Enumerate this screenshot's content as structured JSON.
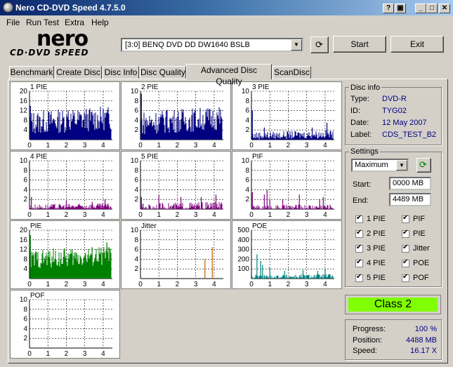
{
  "window": {
    "title": "Nero CD-DVD Speed 4.7.5.0",
    "icon": "cd-icon",
    "controls": [
      "help-icon",
      "restore-icon",
      "minimize-icon",
      "maximize-icon",
      "close-icon"
    ]
  },
  "menu": [
    "File",
    "Run Test",
    "Extra",
    "Help"
  ],
  "logo": {
    "brand": "nero",
    "product": "CD·DVD SPEED"
  },
  "drive": {
    "selected": "[3:0]   BENQ DVD DD DW1640 BSLB"
  },
  "buttons": {
    "start": "Start",
    "exit": "Exit"
  },
  "tabs": [
    "Benchmark",
    "Create Disc",
    "Disc Info",
    "Disc Quality",
    "Advanced Disc Quality",
    "ScanDisc"
  ],
  "active_tab": "Advanced Disc Quality",
  "disc_info": {
    "title": "Disc info",
    "rows": [
      {
        "label": "Type:",
        "value": "DVD-R"
      },
      {
        "label": "ID:",
        "value": "TYG02"
      },
      {
        "label": "Date:",
        "value": "12 May 2007"
      },
      {
        "label": "Label:",
        "value": "CDS_TEST_B2"
      }
    ]
  },
  "settings": {
    "title": "Settings",
    "speed": "Maximum",
    "start_label": "Start:",
    "start_value": "0000 MB",
    "end_label": "End:",
    "end_value": "4489 MB",
    "checkboxes_left": [
      "1 PIE",
      "2 PIE",
      "3 PIE",
      "4 PIE",
      "5 PIE"
    ],
    "checkboxes_right": [
      "PIF",
      "PIE",
      "Jitter",
      "POE",
      "POF"
    ]
  },
  "class_label": "Class 2",
  "status": {
    "progress_label": "Progress:",
    "progress_value": "100 %",
    "position_label": "Position:",
    "position_value": "4488 MB",
    "speed_label": "Speed:",
    "speed_value": "16.17 X"
  },
  "colors": {
    "navy": "#000080",
    "purple": "#800080",
    "green": "#008000",
    "teal": "#008080",
    "orange": "#c06000",
    "class_bg": "#80ff00"
  },
  "chart_data": [
    {
      "type": "bar",
      "title": "1 PIE",
      "ylim": [
        0,
        20
      ],
      "yticks": [
        4,
        8,
        12,
        16,
        20
      ],
      "xticks": [
        0,
        1,
        2,
        3,
        4
      ],
      "xlim": [
        0,
        4.5
      ],
      "color": "navy",
      "base": 7,
      "spread": 5,
      "spikes": [
        [
          0.05,
          14
        ],
        [
          2.1,
          12
        ],
        [
          4.0,
          12
        ]
      ]
    },
    {
      "type": "bar",
      "title": "2 PIE",
      "ylim": [
        0,
        10
      ],
      "yticks": [
        2,
        4,
        6,
        8,
        10
      ],
      "xticks": [
        0,
        1,
        2,
        3,
        4
      ],
      "xlim": [
        0,
        4.5
      ],
      "color": "navy",
      "base": 3.5,
      "spread": 2.5,
      "spikes": [
        [
          0.05,
          9.5
        ],
        [
          1.4,
          6
        ],
        [
          4.2,
          5
        ]
      ]
    },
    {
      "type": "bar",
      "title": "3 PIE",
      "ylim": [
        0,
        10
      ],
      "yticks": [
        2,
        4,
        6,
        8,
        10
      ],
      "xticks": [
        0,
        1,
        2,
        3,
        4
      ],
      "xlim": [
        0,
        4.5
      ],
      "color": "navy",
      "base": 0.8,
      "spread": 0.8,
      "spikes": [
        [
          0.05,
          6
        ],
        [
          0.7,
          2.5
        ],
        [
          3.3,
          2.5
        ],
        [
          4.1,
          3.5
        ]
      ]
    },
    {
      "type": "bar",
      "title": "4 PIE",
      "ylim": [
        0,
        10
      ],
      "yticks": [
        2,
        4,
        6,
        8,
        10
      ],
      "xticks": [
        0,
        1,
        2,
        3,
        4
      ],
      "xlim": [
        0,
        4.5
      ],
      "color": "purple",
      "base": 0.4,
      "spread": 0.6,
      "spikes": [
        [
          0.1,
          2.5
        ],
        [
          2.0,
          1.8
        ],
        [
          3.4,
          1.5
        ],
        [
          4.1,
          2
        ]
      ]
    },
    {
      "type": "bar",
      "title": "5 PIE",
      "ylim": [
        0,
        10
      ],
      "yticks": [
        2,
        4,
        6,
        8,
        10
      ],
      "xticks": [
        0,
        1,
        2,
        3,
        4
      ],
      "xlim": [
        0,
        4.5
      ],
      "color": "purple",
      "base": 0.3,
      "spread": 0.9,
      "spikes": [
        [
          0.05,
          2.5
        ],
        [
          1.0,
          3
        ],
        [
          2.2,
          2.5
        ],
        [
          3.3,
          2.5
        ],
        [
          4.1,
          3
        ]
      ]
    },
    {
      "type": "bar",
      "title": "PIF",
      "ylim": [
        0,
        10
      ],
      "yticks": [
        2,
        4,
        6,
        8,
        10
      ],
      "xticks": [
        0,
        1,
        2,
        3,
        4
      ],
      "xlim": [
        0,
        4.5
      ],
      "color": "purple",
      "base": 0.2,
      "spread": 0.6,
      "spikes": [
        [
          0.05,
          3.5
        ],
        [
          0.7,
          3
        ],
        [
          0.85,
          4
        ],
        [
          1.0,
          2
        ],
        [
          1.7,
          2
        ],
        [
          2.6,
          3
        ],
        [
          3.7,
          2
        ],
        [
          3.9,
          2.5
        ]
      ]
    },
    {
      "type": "bar",
      "title": "PIE",
      "ylim": [
        0,
        20
      ],
      "yticks": [
        4,
        8,
        12,
        16,
        20
      ],
      "xticks": [
        0,
        1,
        2,
        3,
        4
      ],
      "xlim": [
        0,
        4.5
      ],
      "color": "green",
      "base": 8,
      "spread": 4,
      "spikes": [
        [
          0.05,
          18
        ],
        [
          3.4,
          13
        ],
        [
          4.2,
          15
        ]
      ]
    },
    {
      "type": "bar",
      "title": "Jitter",
      "ylim": [
        0,
        10
      ],
      "yticks": [
        2,
        4,
        6,
        8,
        10
      ],
      "xticks": [
        0,
        1,
        2,
        3,
        4
      ],
      "xlim": [
        0,
        4.5
      ],
      "color": "orange",
      "base": 0,
      "spread": 0,
      "spikes": [
        [
          3.5,
          4
        ],
        [
          3.9,
          6.5
        ]
      ]
    },
    {
      "type": "bar",
      "title": "POE",
      "ylim": [
        0,
        500
      ],
      "yticks": [
        100,
        200,
        300,
        400,
        500
      ],
      "xticks": [
        0,
        1,
        2,
        3,
        4
      ],
      "xlim": [
        0,
        4.5
      ],
      "color": "teal",
      "base": 15,
      "spread": 25,
      "spikes": [
        [
          0.3,
          250
        ],
        [
          0.5,
          180
        ],
        [
          0.6,
          140
        ],
        [
          1.0,
          120
        ],
        [
          1.8,
          80
        ],
        [
          2.8,
          90
        ],
        [
          3.6,
          80
        ],
        [
          4.0,
          100
        ]
      ]
    },
    {
      "type": "bar",
      "title": "POF",
      "ylim": [
        0,
        10
      ],
      "yticks": [
        2,
        4,
        6,
        8,
        10
      ],
      "xticks": [
        0,
        1,
        2,
        3,
        4
      ],
      "xlim": [
        0,
        4.5
      ],
      "color": "navy",
      "base": 0,
      "spread": 0,
      "spikes": []
    }
  ]
}
